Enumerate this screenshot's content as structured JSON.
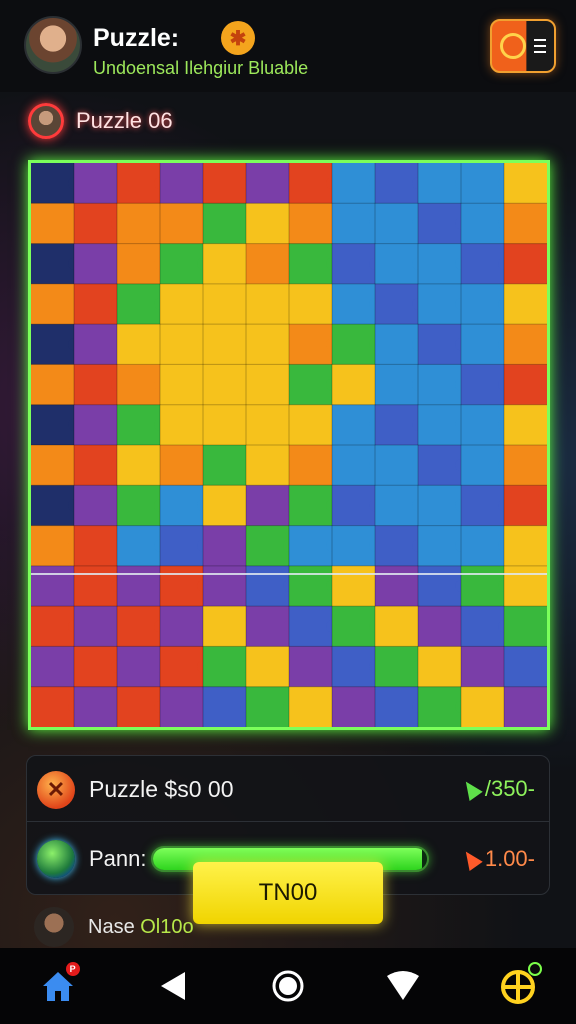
{
  "header": {
    "title": "Puzzle:",
    "title_badge_icon": "star-badge-icon",
    "subtitle": "Undoensal Ilehgiur Bluable",
    "menu_icon": "menu-icon"
  },
  "puzzle_label": {
    "text": "Puzzle 06",
    "accent": "#ff3b3b"
  },
  "board": {
    "border_color": "#7bff5b",
    "palette": [
      "#e2431f",
      "#f38a18",
      "#f6c21c",
      "#39b83d",
      "#2f8fd6",
      "#3f5fc6",
      "#7a3ea8",
      "#1f2f6a"
    ]
  },
  "stats": {
    "puzzle_label": "Puzzle $s0 00",
    "puzzle_value": "/350-",
    "progress_label": "Pann:",
    "progress_fraction": 0.98,
    "progress_value": "1.00-"
  },
  "primary_button": {
    "label": "TN00"
  },
  "user": {
    "name": "Nase ",
    "name_accent": "Ol10o"
  },
  "nav": {
    "home_badge": "P",
    "items": [
      "home-icon",
      "back-icon",
      "circle-icon",
      "heart-icon",
      "grid-icon"
    ]
  },
  "colors": {
    "green": "#7bff5b",
    "yellow": "#ffeb3c",
    "orange": "#f0611b"
  }
}
